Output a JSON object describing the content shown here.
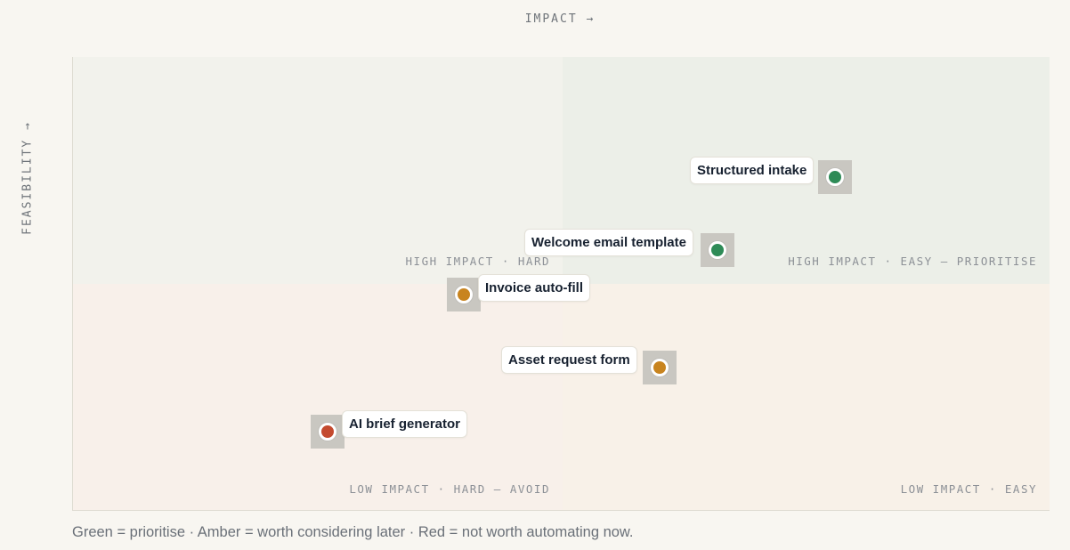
{
  "axes": {
    "x_label": "IMPACT →",
    "y_label": "FEASIBILITY →"
  },
  "quadrants": {
    "top_left": "HIGH IMPACT · HARD",
    "top_right": "HIGH IMPACT · EASY — PRIORITISE",
    "bottom_left": "LOW IMPACT · HARD — AVOID",
    "bottom_right": "LOW IMPACT · EASY"
  },
  "items": [
    {
      "label": "Structured intake",
      "status": "green"
    },
    {
      "label": "Welcome email template",
      "status": "green"
    },
    {
      "label": "Invoice auto-fill",
      "status": "amber"
    },
    {
      "label": "Asset request form",
      "status": "amber"
    },
    {
      "label": "AI brief generator",
      "status": "red"
    }
  ],
  "legend": "Green = prioritise · Amber = worth considering later · Red = not worth automating now.",
  "colors": {
    "green": "#2e8b57",
    "amber": "#c8841f",
    "red": "#c44a2f"
  }
}
